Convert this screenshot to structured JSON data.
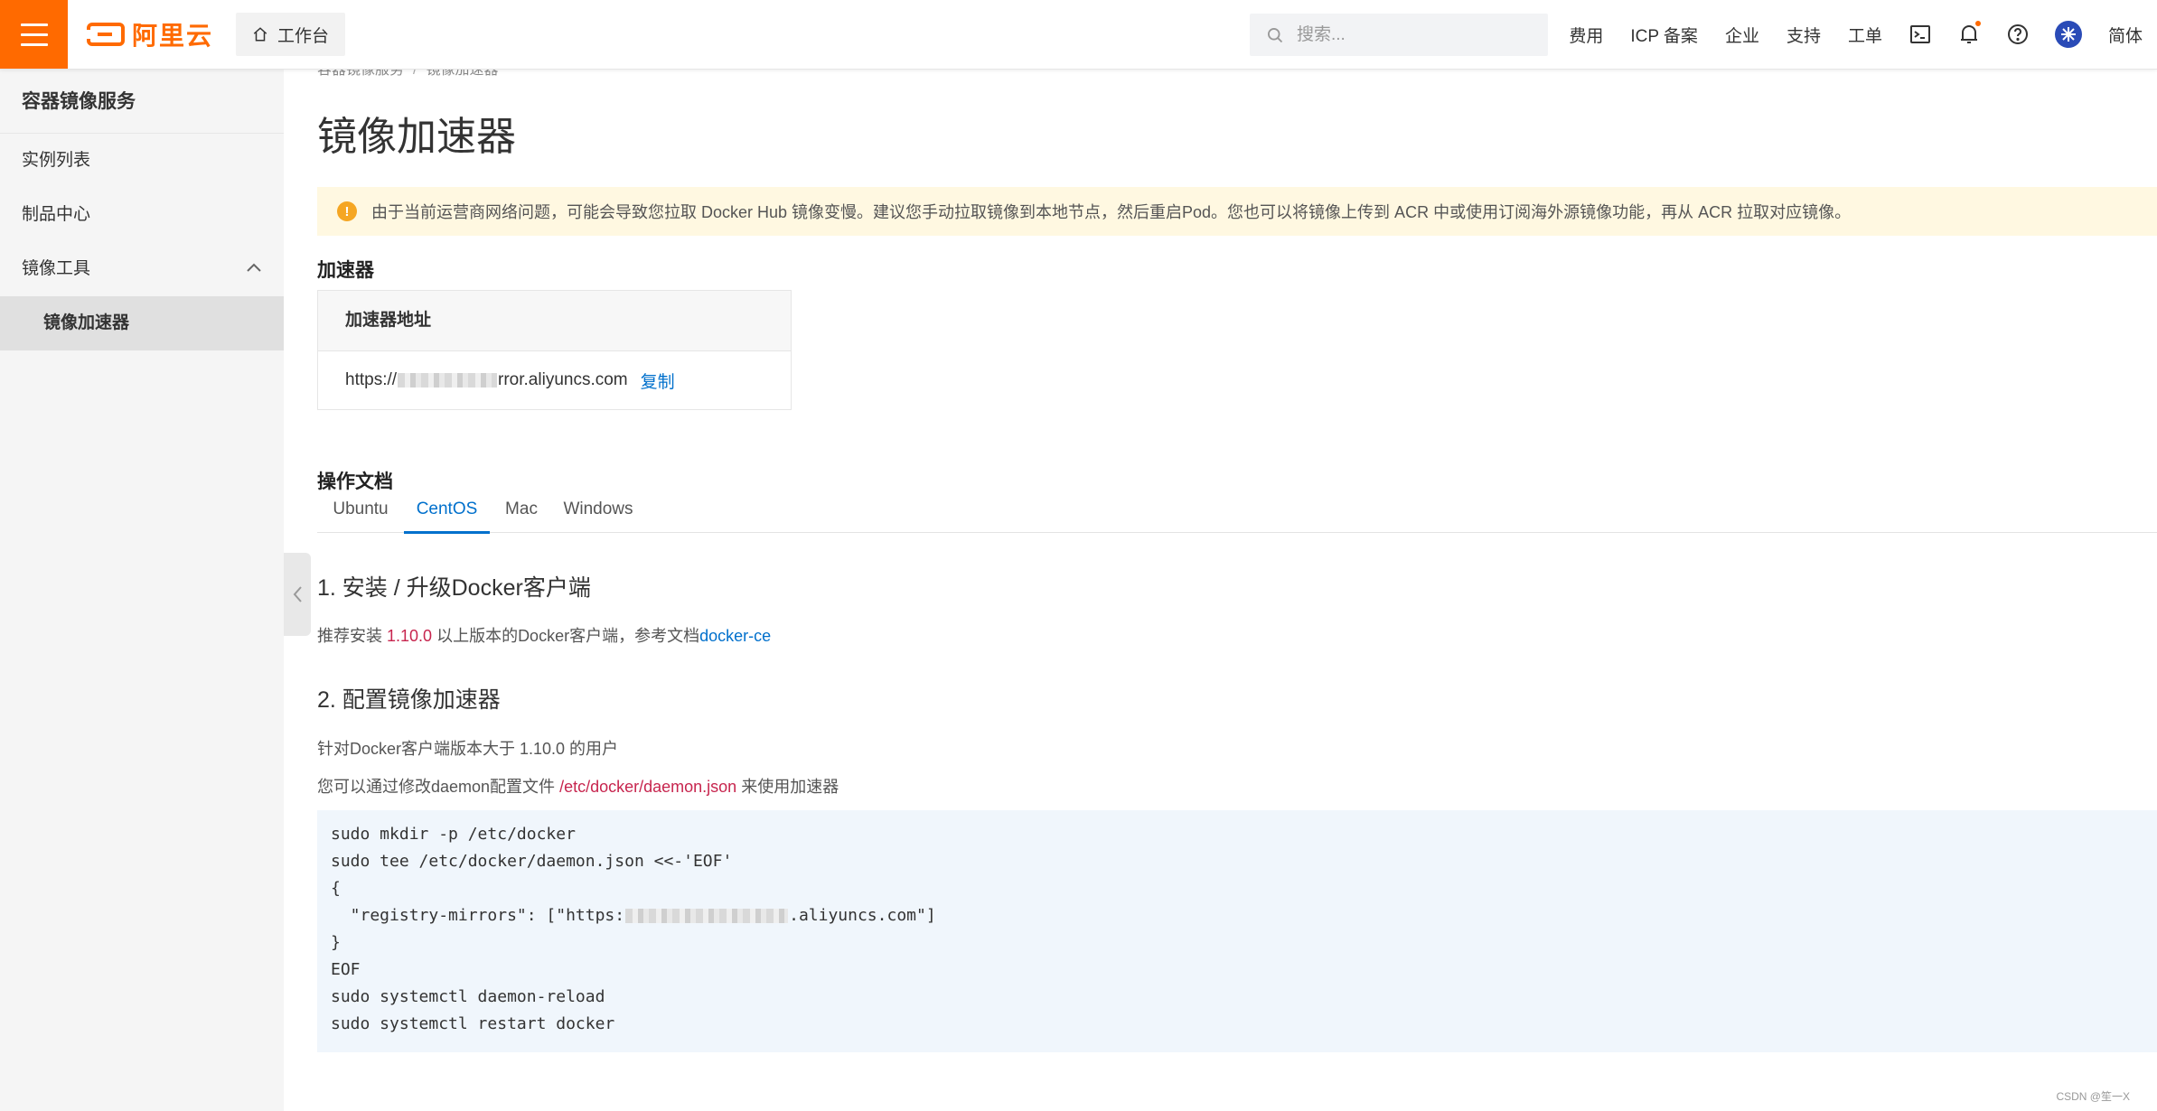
{
  "header": {
    "logo_text": "阿里云",
    "workbench_label": "工作台",
    "search_placeholder": "搜索...",
    "nav_links": [
      "费用",
      "ICP 备案",
      "企业",
      "支持",
      "工单"
    ],
    "language_label": "简体",
    "brand_color": "#ff6a00"
  },
  "sidebar": {
    "title": "容器镜像服务",
    "items": [
      "实例列表",
      "制品中心",
      "镜像工具"
    ],
    "sub_item": "镜像加速器"
  },
  "breadcrumb": [
    "容器镜像服务",
    "镜像加速器"
  ],
  "breadcrumb_separator": "/",
  "page": {
    "title": "镜像加速器",
    "alert": "由于当前运营商网络问题，可能会导致您拉取 Docker Hub 镜像变慢。建议您手动拉取镜像到本地节点，然后重启Pod。您也可以将镜像上传到 ACR 中或使用订阅海外源镜像功能，再从 ACR 拉取对应镜像。",
    "accelerator_heading": "加速器",
    "accelerator_table": {
      "header": "加速器地址",
      "url_prefix": "https://",
      "url_suffix": "rror.aliyuncs.com",
      "copy_label": "复制"
    },
    "docs_heading": "操作文档",
    "tabs": [
      "Ubuntu",
      "CentOS",
      "Mac",
      "Windows"
    ],
    "active_tab": "CentOS",
    "step1_title": "1. 安装 / 升级Docker客户端",
    "step1_text_a": "推荐安装 ",
    "step1_version": "1.10.0",
    "step1_text_b": " 以上版本的Docker客户端，参考文档",
    "step1_link": "docker-ce",
    "step2_title": "2. 配置镜像加速器",
    "step2_text1": "针对Docker客户端版本大于 1.10.0 的用户",
    "step2_text2_a": "您可以通过修改daemon配置文件 ",
    "step2_path": "/etc/docker/daemon.json",
    "step2_text2_b": " 来使用加速器",
    "code": {
      "line1": "sudo mkdir -p /etc/docker",
      "line2": "sudo tee /etc/docker/daemon.json <<-'EOF'",
      "line3": "{",
      "line4_a": "  \"registry-mirrors\": [\"https:",
      "line4_b": ".aliyuncs.com\"]",
      "line5": "}",
      "line6": "EOF",
      "line7": "sudo systemctl daemon-reload",
      "line8": "sudo systemctl restart docker"
    }
  },
  "watermark": "CSDN @笙一X"
}
